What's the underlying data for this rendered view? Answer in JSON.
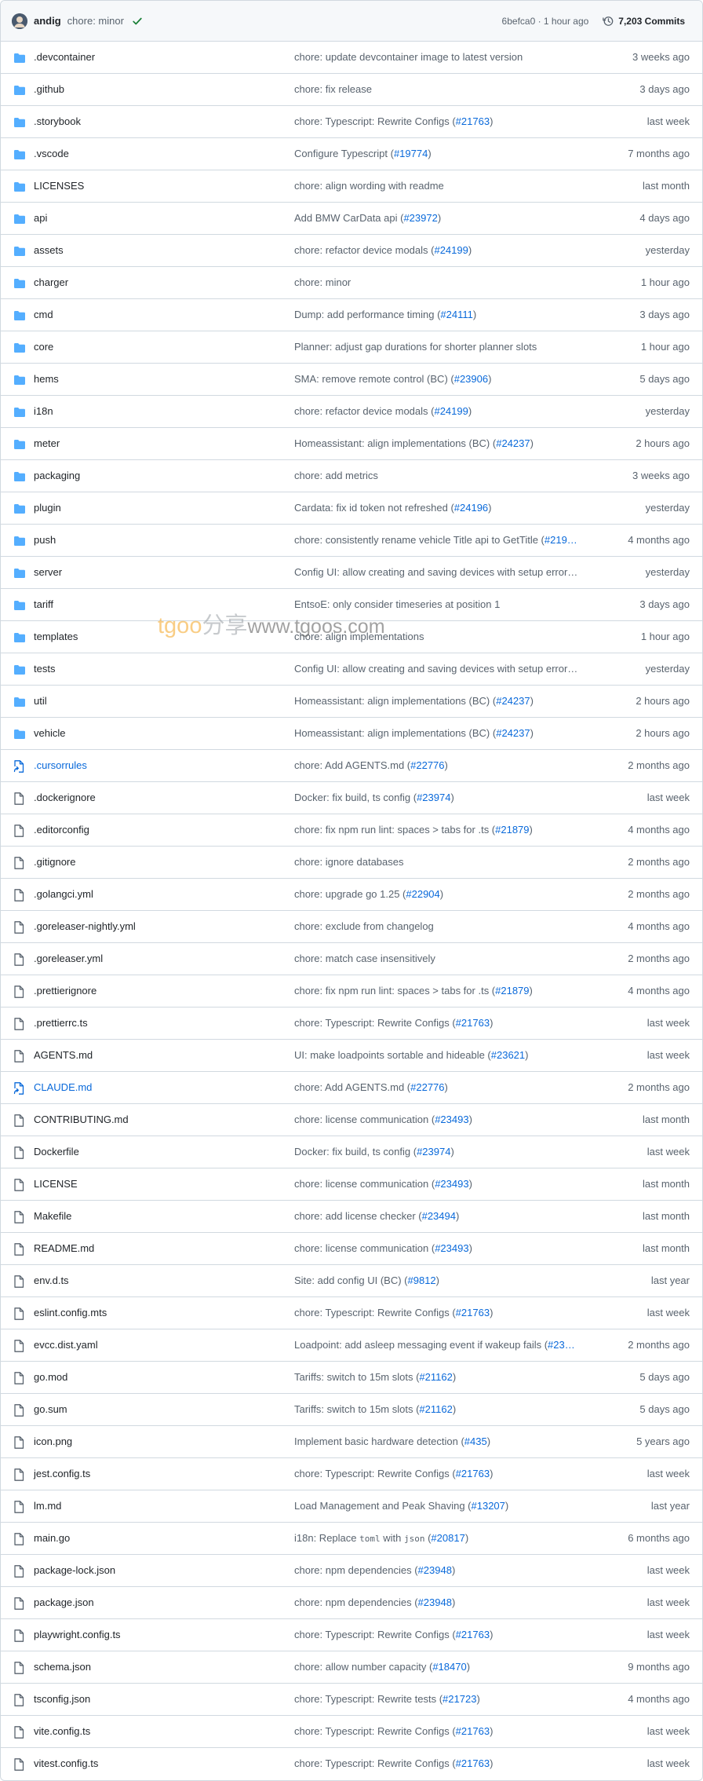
{
  "header": {
    "author": "andig",
    "message": "chore: minor",
    "sha_time": "6befca0 · 1 hour ago",
    "commits": "7,203 Commits"
  },
  "icons": {
    "folder": "folder-icon",
    "file": "file-icon",
    "symlink": "symlink-file-icon",
    "check": "check-icon",
    "history": "history-icon"
  },
  "colors": {
    "folder": "#54aeff",
    "link": "#0969da",
    "muted": "#59636e",
    "success": "#1a7f37"
  },
  "watermark": {
    "a": "tgoo",
    "b": "分享",
    "c": "www.tgoos.com"
  },
  "rows": [
    {
      "type": "folder",
      "name": ".devcontainer",
      "msg": "chore: update devcontainer image to latest version",
      "pr": "",
      "msg_after": "",
      "age": "3 weeks ago"
    },
    {
      "type": "folder",
      "name": ".github",
      "msg": "chore: fix release",
      "pr": "",
      "msg_after": "",
      "age": "3 days ago"
    },
    {
      "type": "folder",
      "name": ".storybook",
      "msg": "chore: Typescript: Rewrite Configs (",
      "pr": "#21763",
      "msg_after": ")",
      "age": "last week"
    },
    {
      "type": "folder",
      "name": ".vscode",
      "msg": "Configure Typescript (",
      "pr": "#19774",
      "msg_after": ")",
      "age": "7 months ago"
    },
    {
      "type": "folder",
      "name": "LICENSES",
      "msg": "chore: align wording with readme",
      "pr": "",
      "msg_after": "",
      "age": "last month"
    },
    {
      "type": "folder",
      "name": "api",
      "msg": "Add BMW CarData api (",
      "pr": "#23972",
      "msg_after": ")",
      "age": "4 days ago"
    },
    {
      "type": "folder",
      "name": "assets",
      "msg": "chore: refactor device modals (",
      "pr": "#24199",
      "msg_after": ")",
      "age": "yesterday"
    },
    {
      "type": "folder",
      "name": "charger",
      "msg": "chore: minor",
      "pr": "",
      "msg_after": "",
      "age": "1 hour ago"
    },
    {
      "type": "folder",
      "name": "cmd",
      "msg": "Dump: add performance timing (",
      "pr": "#24111",
      "msg_after": ")",
      "age": "3 days ago"
    },
    {
      "type": "folder",
      "name": "core",
      "msg": "Planner: adjust gap durations for shorter planner slots",
      "pr": "",
      "msg_after": "",
      "age": "1 hour ago"
    },
    {
      "type": "folder",
      "name": "hems",
      "msg": "SMA: remove remote control (BC) (",
      "pr": "#23906",
      "msg_after": ")",
      "age": "5 days ago"
    },
    {
      "type": "folder",
      "name": "i18n",
      "msg": "chore: refactor device modals (",
      "pr": "#24199",
      "msg_after": ")",
      "age": "yesterday"
    },
    {
      "type": "folder",
      "name": "meter",
      "msg": "Homeassistant: align implementations (BC) (",
      "pr": "#24237",
      "msg_after": ")",
      "age": "2 hours ago"
    },
    {
      "type": "folder",
      "name": "packaging",
      "msg": "chore: add metrics",
      "pr": "",
      "msg_after": "",
      "age": "3 weeks ago"
    },
    {
      "type": "folder",
      "name": "plugin",
      "msg": "Cardata: fix id token not refreshed (",
      "pr": "#24196",
      "msg_after": ")",
      "age": "yesterday"
    },
    {
      "type": "folder",
      "name": "push",
      "msg": "chore: consistently rename vehicle Title api to GetTitle (",
      "pr": "#219…",
      "msg_after": "",
      "age": "4 months ago"
    },
    {
      "type": "folder",
      "name": "server",
      "msg": "Config UI: allow creating and saving devices with setup error…",
      "pr": "",
      "msg_after": "",
      "age": "yesterday"
    },
    {
      "type": "folder",
      "name": "tariff",
      "msg": "EntsoE: only consider timeseries at position 1",
      "pr": "",
      "msg_after": "",
      "age": "3 days ago"
    },
    {
      "type": "folder",
      "name": "templates",
      "msg": "chore: align implementations",
      "pr": "",
      "msg_after": "",
      "age": "1 hour ago"
    },
    {
      "type": "folder",
      "name": "tests",
      "msg": "Config UI: allow creating and saving devices with setup error…",
      "pr": "",
      "msg_after": "",
      "age": "yesterday"
    },
    {
      "type": "folder",
      "name": "util",
      "msg": "Homeassistant: align implementations (BC) (",
      "pr": "#24237",
      "msg_after": ")",
      "age": "2 hours ago"
    },
    {
      "type": "folder",
      "name": "vehicle",
      "msg": "Homeassistant: align implementations (BC) (",
      "pr": "#24237",
      "msg_after": ")",
      "age": "2 hours ago"
    },
    {
      "type": "symlink",
      "name": ".cursorrules",
      "msg": "chore: Add AGENTS.md (",
      "pr": "#22776",
      "msg_after": ")",
      "age": "2 months ago"
    },
    {
      "type": "file",
      "name": ".dockerignore",
      "msg": "Docker: fix build, ts config (",
      "pr": "#23974",
      "msg_after": ")",
      "age": "last week"
    },
    {
      "type": "file",
      "name": ".editorconfig",
      "msg": "chore: fix npm run lint: spaces > tabs for .ts (",
      "pr": "#21879",
      "msg_after": ")",
      "age": "4 months ago"
    },
    {
      "type": "file",
      "name": ".gitignore",
      "msg": "chore: ignore databases",
      "pr": "",
      "msg_after": "",
      "age": "2 months ago"
    },
    {
      "type": "file",
      "name": ".golangci.yml",
      "msg": "chore: upgrade go 1.25 (",
      "pr": "#22904",
      "msg_after": ")",
      "age": "2 months ago"
    },
    {
      "type": "file",
      "name": ".goreleaser-nightly.yml",
      "msg": "chore: exclude from changelog",
      "pr": "",
      "msg_after": "",
      "age": "4 months ago"
    },
    {
      "type": "file",
      "name": ".goreleaser.yml",
      "msg": "chore: match case insensitively",
      "pr": "",
      "msg_after": "",
      "age": "2 months ago"
    },
    {
      "type": "file",
      "name": ".prettierignore",
      "msg": "chore: fix npm run lint: spaces > tabs for .ts (",
      "pr": "#21879",
      "msg_after": ")",
      "age": "4 months ago"
    },
    {
      "type": "file",
      "name": ".prettierrc.ts",
      "msg": "chore: Typescript: Rewrite Configs (",
      "pr": "#21763",
      "msg_after": ")",
      "age": "last week"
    },
    {
      "type": "file",
      "name": "AGENTS.md",
      "msg": "UI: make loadpoints sortable and hideable (",
      "pr": "#23621",
      "msg_after": ")",
      "age": "last week"
    },
    {
      "type": "symlink",
      "name": "CLAUDE.md",
      "msg": "chore: Add AGENTS.md (",
      "pr": "#22776",
      "msg_after": ")",
      "age": "2 months ago"
    },
    {
      "type": "file",
      "name": "CONTRIBUTING.md",
      "msg": "chore: license communication (",
      "pr": "#23493",
      "msg_after": ")",
      "age": "last month"
    },
    {
      "type": "file",
      "name": "Dockerfile",
      "msg": "Docker: fix build, ts config (",
      "pr": "#23974",
      "msg_after": ")",
      "age": "last week"
    },
    {
      "type": "file",
      "name": "LICENSE",
      "msg": "chore: license communication (",
      "pr": "#23493",
      "msg_after": ")",
      "age": "last month"
    },
    {
      "type": "file",
      "name": "Makefile",
      "msg": "chore: add license checker (",
      "pr": "#23494",
      "msg_after": ")",
      "age": "last month"
    },
    {
      "type": "file",
      "name": "README.md",
      "msg": "chore: license communication (",
      "pr": "#23493",
      "msg_after": ")",
      "age": "last month"
    },
    {
      "type": "file",
      "name": "env.d.ts",
      "msg": "Site: add config UI (BC) (",
      "pr": "#9812",
      "msg_after": ")",
      "age": "last year"
    },
    {
      "type": "file",
      "name": "eslint.config.mts",
      "msg": "chore: Typescript: Rewrite Configs (",
      "pr": "#21763",
      "msg_after": ")",
      "age": "last week"
    },
    {
      "type": "file",
      "name": "evcc.dist.yaml",
      "msg": "Loadpoint: add asleep messaging event if wakeup fails (",
      "pr": "#23…",
      "msg_after": "",
      "age": "2 months ago"
    },
    {
      "type": "file",
      "name": "go.mod",
      "msg": "Tariffs: switch to 15m slots (",
      "pr": "#21162",
      "msg_after": ")",
      "age": "5 days ago"
    },
    {
      "type": "file",
      "name": "go.sum",
      "msg": "Tariffs: switch to 15m slots (",
      "pr": "#21162",
      "msg_after": ")",
      "age": "5 days ago"
    },
    {
      "type": "file",
      "name": "icon.png",
      "msg": "Implement basic hardware detection (",
      "pr": "#435",
      "msg_after": ")",
      "age": "5 years ago"
    },
    {
      "type": "file",
      "name": "jest.config.ts",
      "msg": "chore: Typescript: Rewrite Configs (",
      "pr": "#21763",
      "msg_after": ")",
      "age": "last week"
    },
    {
      "type": "file",
      "name": "lm.md",
      "msg": "Load Management and Peak Shaving (",
      "pr": "#13207",
      "msg_after": ")",
      "age": "last year"
    },
    {
      "type": "file",
      "name": "main.go",
      "msg": "i18n: Replace ",
      "code1": "toml",
      "mid": " with ",
      "code2": "json",
      "msg2": " (",
      "pr": "#20817",
      "msg_after": ")",
      "age": "6 months ago"
    },
    {
      "type": "file",
      "name": "package-lock.json",
      "msg": "chore: npm dependencies (",
      "pr": "#23948",
      "msg_after": ")",
      "age": "last week"
    },
    {
      "type": "file",
      "name": "package.json",
      "msg": "chore: npm dependencies (",
      "pr": "#23948",
      "msg_after": ")",
      "age": "last week"
    },
    {
      "type": "file",
      "name": "playwright.config.ts",
      "msg": "chore: Typescript: Rewrite Configs (",
      "pr": "#21763",
      "msg_after": ")",
      "age": "last week"
    },
    {
      "type": "file",
      "name": "schema.json",
      "msg": "chore: allow number capacity (",
      "pr": "#18470",
      "msg_after": ")",
      "age": "9 months ago"
    },
    {
      "type": "file",
      "name": "tsconfig.json",
      "msg": "chore: Typescript: Rewrite tests (",
      "pr": "#21723",
      "msg_after": ")",
      "age": "4 months ago"
    },
    {
      "type": "file",
      "name": "vite.config.ts",
      "msg": "chore: Typescript: Rewrite Configs (",
      "pr": "#21763",
      "msg_after": ")",
      "age": "last week"
    },
    {
      "type": "file",
      "name": "vitest.config.ts",
      "msg": "chore: Typescript: Rewrite Configs (",
      "pr": "#21763",
      "msg_after": ")",
      "age": "last week"
    }
  ]
}
